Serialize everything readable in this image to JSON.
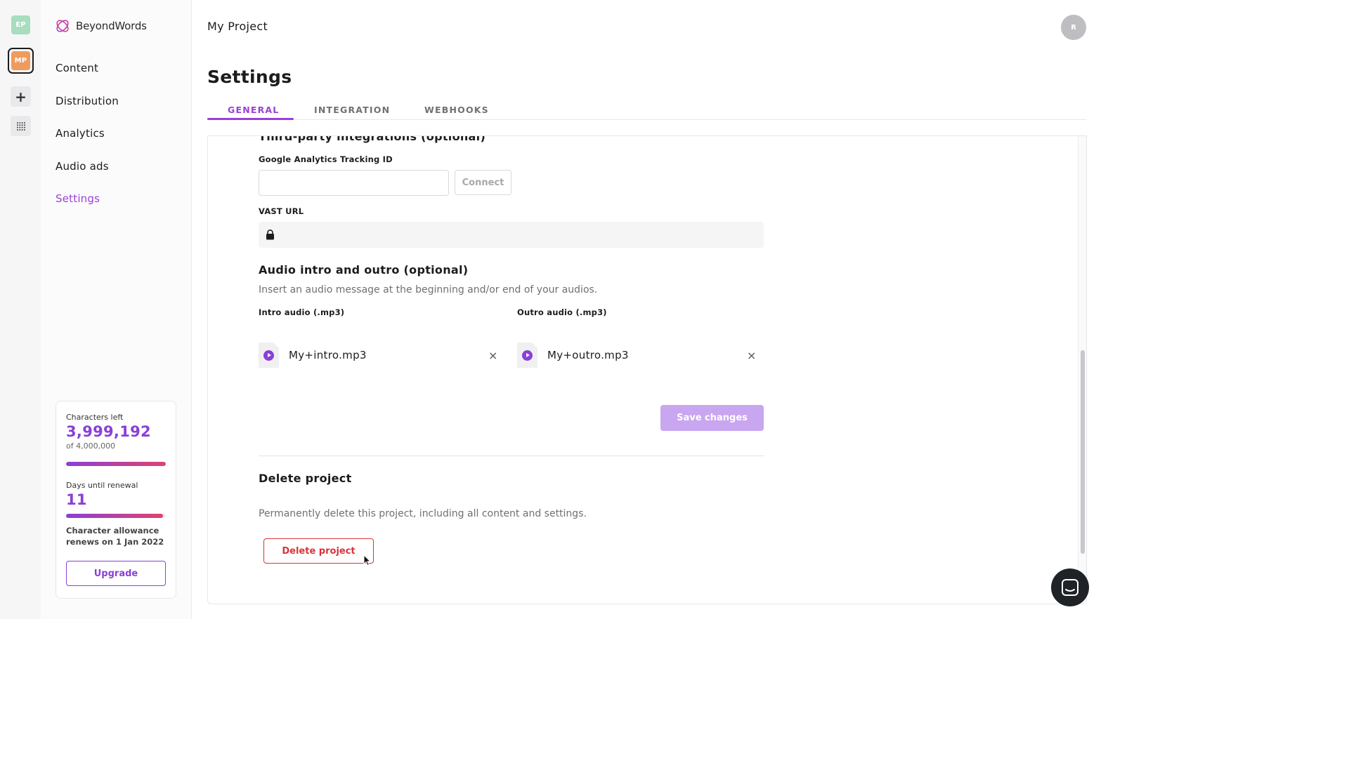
{
  "rail": {
    "projects": [
      "EP",
      "MP"
    ],
    "colors": {
      "ep": "#a8ddbd",
      "mp": "#f09b5e"
    }
  },
  "brand": {
    "name": "BeyondWords",
    "accent": "#9b3fd6"
  },
  "nav": {
    "items": [
      {
        "label": "Content"
      },
      {
        "label": "Distribution"
      },
      {
        "label": "Analytics"
      },
      {
        "label": "Audio ads"
      },
      {
        "label": "Settings",
        "active": true
      }
    ]
  },
  "usage": {
    "chars_label": "Characters left",
    "chars_value": "3,999,192",
    "chars_total": "of 4,000,000",
    "chars_fraction": 0.9998,
    "days_label": "Days until renewal",
    "days_value": "11",
    "days_fraction": 0.97,
    "note": "Character allowance renews on 1 Jan 2022",
    "upgrade_label": "Upgrade"
  },
  "header": {
    "breadcrumb": "My Project",
    "avatar": "R",
    "title": "Settings"
  },
  "tabs": [
    {
      "label": "GENERAL",
      "active": true
    },
    {
      "label": "INTEGRATION"
    },
    {
      "label": "WEBHOOKS"
    }
  ],
  "integrations": {
    "heading": "Third-party integrations (optional)",
    "ga_label": "Google Analytics Tracking ID",
    "ga_value": "",
    "connect_label": "Connect",
    "vast_label": "VAST URL"
  },
  "audio": {
    "heading": "Audio intro and outro (optional)",
    "description": "Insert an audio message at the beginning and/or end of your audios.",
    "intro_label": "Intro audio (.mp3)",
    "intro_file": "My+intro.mp3",
    "outro_label": "Outro audio (.mp3)",
    "outro_file": "My+outro.mp3",
    "remove_symbol": "×"
  },
  "save_label": "Save changes",
  "delete": {
    "heading": "Delete project",
    "description": "Permanently delete this project, including all content and settings.",
    "button_label": "Delete project"
  }
}
